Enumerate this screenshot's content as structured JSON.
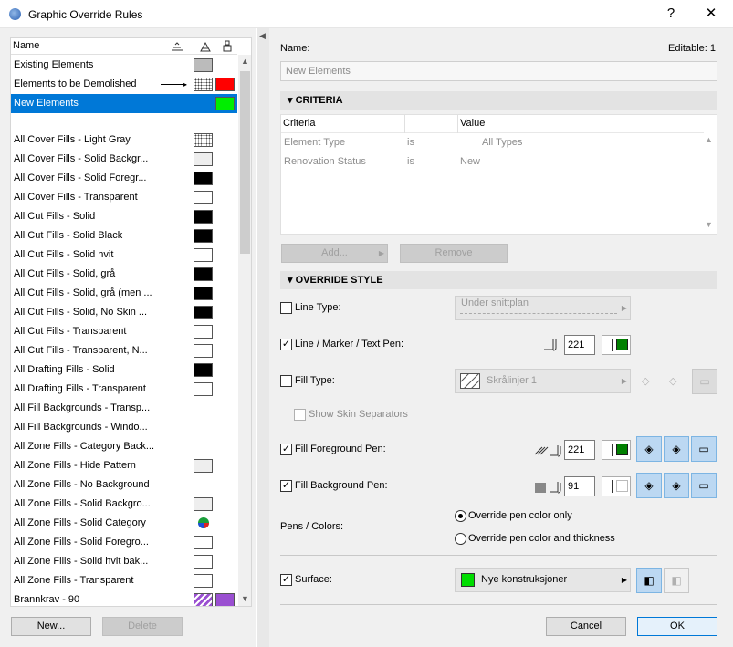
{
  "window": {
    "title": "Graphic Override Rules",
    "help": "?",
    "close": "✕"
  },
  "list": {
    "header": {
      "name": "Name"
    },
    "top_rows": [
      {
        "label": "Existing Elements",
        "swatch": "#bbbbbb"
      },
      {
        "label": "Elements to be Demolished",
        "swatch": "#ff0000"
      },
      {
        "label": "New Elements",
        "swatch": "#00ee00",
        "selected": true
      }
    ],
    "rows": [
      {
        "label": "All Cover Fills - Light Gray",
        "swatch": "dots"
      },
      {
        "label": "All Cover Fills - Solid Backgr...",
        "swatch": "#eeeeee"
      },
      {
        "label": "All Cover Fills - Solid Foregr...",
        "swatch": "#000000"
      },
      {
        "label": "All Cover Fills - Transparent",
        "swatch": "#ffffff"
      },
      {
        "label": "All Cut Fills - Solid",
        "swatch": "#000000"
      },
      {
        "label": "All Cut Fills - Solid Black",
        "swatch": "#000000"
      },
      {
        "label": "All Cut Fills - Solid hvit",
        "swatch": "#ffffff"
      },
      {
        "label": "All Cut Fills - Solid, grå",
        "swatch": "#000000"
      },
      {
        "label": "All Cut Fills - Solid, grå (men ...",
        "swatch": "#000000"
      },
      {
        "label": "All Cut Fills - Solid, No Skin ...",
        "swatch": "#000000"
      },
      {
        "label": "All Cut Fills - Transparent",
        "swatch": "#ffffff"
      },
      {
        "label": "All Cut Fills - Transparent, N...",
        "swatch": "#ffffff"
      },
      {
        "label": "All Drafting Fills - Solid",
        "swatch": "#000000"
      },
      {
        "label": "All Drafting Fills - Transparent",
        "swatch": "#ffffff"
      },
      {
        "label": "All Fill Backgrounds - Transp...",
        "swatch": ""
      },
      {
        "label": "All Fill Backgrounds - Windo...",
        "swatch": ""
      },
      {
        "label": "All Zone Fills - Category Back...",
        "swatch": ""
      },
      {
        "label": "All Zone Fills - Hide Pattern",
        "swatch": "#eeeeee"
      },
      {
        "label": "All Zone Fills - No Background",
        "swatch": ""
      },
      {
        "label": "All Zone Fills - Solid Backgro...",
        "swatch": "#eeeeee"
      },
      {
        "label": "All Zone Fills - Solid Category",
        "swatch": "category"
      },
      {
        "label": "All Zone Fills - Solid Foregro...",
        "swatch": "#ffffff"
      },
      {
        "label": "All Zone Fills - Solid hvit bak...",
        "swatch": "#ffffff"
      },
      {
        "label": "All Zone Fills - Transparent",
        "swatch": "#ffffff"
      },
      {
        "label": "Brannkrav - 90",
        "swatch": "#9a4fd1"
      }
    ]
  },
  "buttons": {
    "new": "New...",
    "delete": "Delete",
    "add": "Add...",
    "remove": "Remove",
    "cancel": "Cancel",
    "ok": "OK"
  },
  "details": {
    "name_label": "Name:",
    "editable": "Editable: 1",
    "name_value": "New Elements",
    "criteria_title": "CRITERIA",
    "criteria_headers": {
      "criteria": "Criteria",
      "value": "Value"
    },
    "criteria_rows": [
      {
        "criteria": "Element Type",
        "op": "is",
        "value": "All Types"
      },
      {
        "criteria": "Renovation Status",
        "op": "is",
        "value": "New"
      }
    ],
    "override_title": "OVERRIDE STYLE",
    "line_type": {
      "label": "Line Type:",
      "value": "Under snittplan"
    },
    "line_pen": {
      "label": "Line / Marker / Text Pen:",
      "value": "221",
      "color": "#008000"
    },
    "fill_type": {
      "label": "Fill Type:",
      "value": "Skrålinjer 1"
    },
    "show_skin": "Show Skin Separators",
    "fill_fg": {
      "label": "Fill Foreground Pen:",
      "value": "221",
      "color": "#008000"
    },
    "fill_bg": {
      "label": "Fill Background Pen:",
      "value": "91",
      "color": "#ffffff"
    },
    "pens_label": "Pens / Colors:",
    "radio1": "Override pen color only",
    "radio2": "Override pen color and thickness",
    "surface": {
      "label": "Surface:",
      "value": "Nye konstruksjoner",
      "color": "#00dd00"
    }
  }
}
